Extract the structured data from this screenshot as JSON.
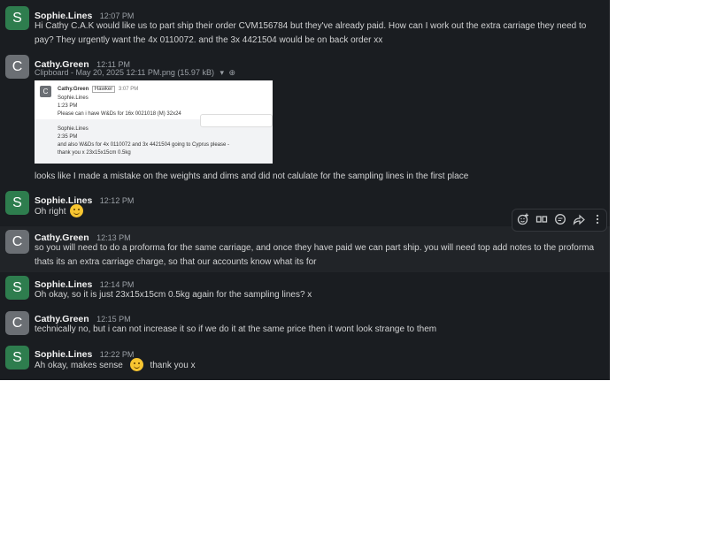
{
  "messages": [
    {
      "author": "Sophie.Lines",
      "initial": "S",
      "time": "12:07 PM",
      "text": "Hi Cathy    C.A.K would like us to part ship their order CVM156784    but they've already paid. How can I work out the extra carriage they need to pay? They urgently want the 4x 0110072. and the 3x 4421504 would be on back order xx"
    },
    {
      "author": "Cathy.Green",
      "initial": "C",
      "time": "12:11 PM",
      "attachment_meta": "Clipboard - May 20, 2025 12:11 PM.png (15.97 kB)",
      "text": "looks like I made a mistake on the weights and dims and did not calulate for the sampling lines in the first place"
    },
    {
      "author": "Sophie.Lines",
      "initial": "S",
      "time": "12:12 PM",
      "text": "Oh right"
    },
    {
      "author": "Cathy.Green",
      "initial": "C",
      "time": "12:13 PM",
      "text": "so you will need to do a proforma for the same carriage, and once they have paid we can part ship. you will need top add notes to the proforma thats its an extra carriage charge, so that our accounts know what its for"
    },
    {
      "author": "Sophie.Lines",
      "initial": "S",
      "time": "12:14 PM",
      "text": "Oh okay, so it is just 23x15x15cm 0.5kg again for the sampling lines? x"
    },
    {
      "author": "Cathy.Green",
      "initial": "C",
      "time": "12:15 PM",
      "text": "technically no, but i can not increase it so if we do it at the same price then it wont look strange to them"
    },
    {
      "author": "Sophie.Lines",
      "initial": "S",
      "time": "12:22 PM",
      "text_a": "Ah okay, makes sense",
      "text_b": "thank you x"
    }
  ],
  "attachment_preview": {
    "author": "Cathy.Green",
    "badge": "Hawker",
    "time": "3:07 PM",
    "line1": "Sophie.Lines",
    "line2": "1:23 PM",
    "line3": "Please can i have W&Ds for 16x 0021018 (M) 32x24",
    "line4": "Sophie.Lines",
    "line5": "2:35 PM",
    "line6": "and also W&Ds for 4x 0110072 and 3x 4421504 going to Cyprus please -",
    "line7": "thank you x 23x15x15cm 0.5kg"
  },
  "toolbar": {
    "icons": [
      "add-reaction-icon",
      "quote-icon",
      "reply-icon",
      "share-icon",
      "more-icon"
    ]
  }
}
